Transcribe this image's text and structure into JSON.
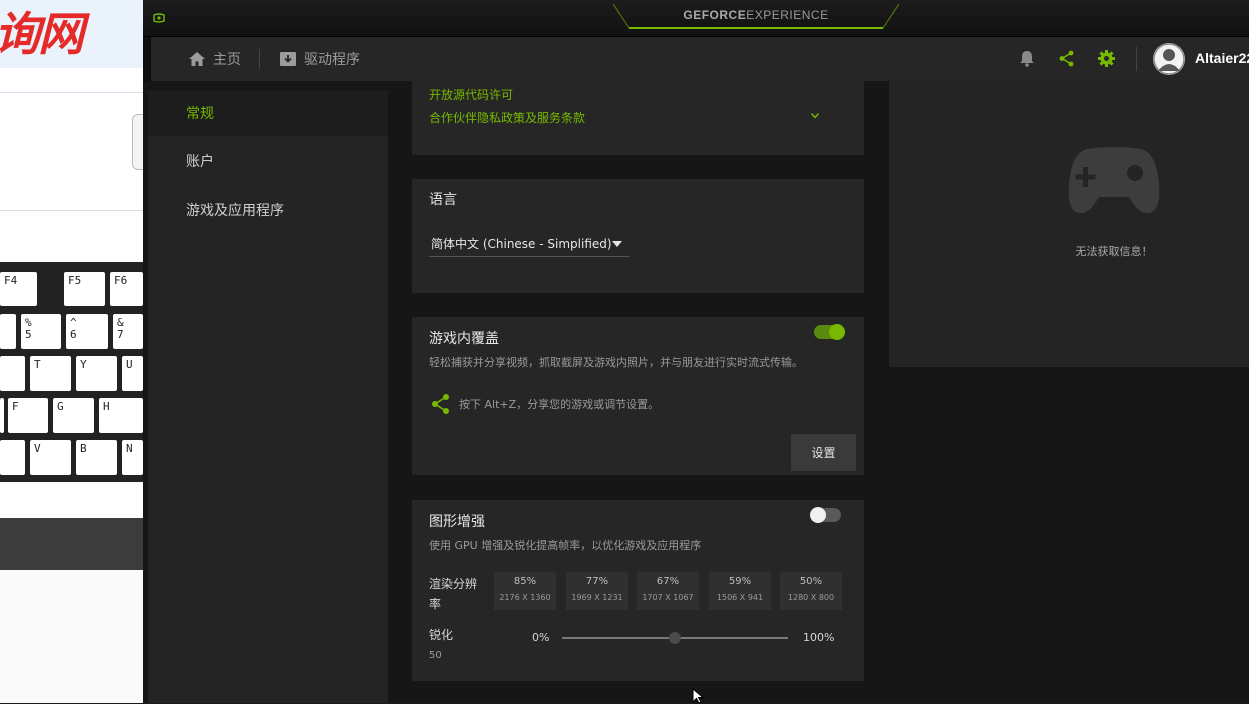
{
  "background_window": {
    "title_text": "询网",
    "keys": [
      {
        "label": "F4"
      },
      {
        "label": "F5"
      },
      {
        "label": "F6"
      },
      {
        "label": "%\n5"
      },
      {
        "label": "^\n6"
      },
      {
        "label": "&\n7"
      },
      {
        "label": "T"
      },
      {
        "label": "Y"
      },
      {
        "label": "U"
      },
      {
        "label": "F"
      },
      {
        "label": "G"
      },
      {
        "label": "H"
      },
      {
        "label": "V"
      },
      {
        "label": "B"
      },
      {
        "label": "N"
      }
    ]
  },
  "app": {
    "brand_bold": "GEFORCE",
    "brand_light": "EXPERIENCE",
    "accent_color": "#76b900"
  },
  "navbar": {
    "home_label": "主页",
    "drivers_label": "驱动程序",
    "username": "Altaier22"
  },
  "sidebar": {
    "items": [
      {
        "label": "常规",
        "active": true
      },
      {
        "label": "账户",
        "active": false
      },
      {
        "label": "游戏及应用程序",
        "active": false
      }
    ]
  },
  "about_card": {
    "link1": "开放源代码许可",
    "link2": "合作伙伴隐私政策及服务条款"
  },
  "language_card": {
    "title": "语言",
    "selected": "简体中文 (Chinese - Simplified)"
  },
  "overlay_card": {
    "title": "游戏内覆盖",
    "enabled": true,
    "description": "轻松捕获并分享视频，抓取截屏及游戏内照片，并与朋友进行实时流式传输。",
    "hint": "按下 Alt+Z，分享您的游戏或调节设置。",
    "settings_button": "设置"
  },
  "graphics_card": {
    "title": "图形增强",
    "enabled": false,
    "description": "使用 GPU 增强及锐化提高帧率，以优化游戏及应用程序",
    "resolution_label": "渲染分辨率",
    "resolutions": [
      {
        "percent": "85%",
        "dims": "2176 X 1360"
      },
      {
        "percent": "77%",
        "dims": "1969 X 1231"
      },
      {
        "percent": "67%",
        "dims": "1707 X 1067"
      },
      {
        "percent": "59%",
        "dims": "1506 X 941"
      },
      {
        "percent": "50%",
        "dims": "1280 X 800"
      }
    ],
    "sharpen_label": "锐化",
    "sharpen_value": "50",
    "slider_min": "0%",
    "slider_max": "100%",
    "slider_fraction": 0.5
  },
  "right_panel": {
    "message": "无法获取信息！",
    "icon": "gamepad-icon"
  }
}
